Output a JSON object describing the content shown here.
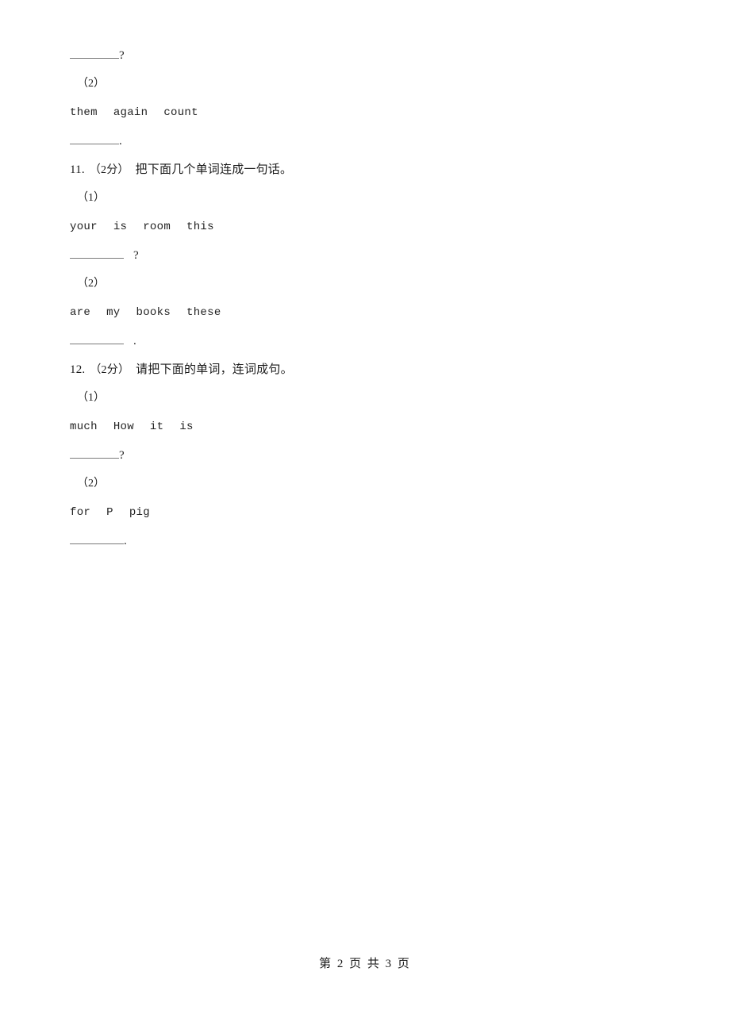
{
  "document": {
    "background_color": "#ffffff",
    "text_color": "#1a1a1a",
    "blank_color": "#7a7a7a"
  },
  "body_lines": [
    {
      "kind": "answer",
      "blank_width": "w62",
      "gap": false,
      "punct": "?"
    },
    {
      "kind": "sub-marker",
      "marker": "（2）"
    },
    {
      "kind": "words",
      "words": [
        "them",
        "again",
        "count"
      ]
    },
    {
      "kind": "answer",
      "blank_width": "w62",
      "gap": false,
      "punct": "."
    },
    {
      "kind": "question",
      "number": "11.",
      "score": "（2分）",
      "text": "把下面几个单词连成一句话。"
    },
    {
      "kind": "sub-marker",
      "marker": "（1）"
    },
    {
      "kind": "words",
      "words": [
        "your",
        "is",
        "room",
        "this"
      ]
    },
    {
      "kind": "answer",
      "blank_width": "w68",
      "gap": true,
      "punct": "?"
    },
    {
      "kind": "sub-marker",
      "marker": "（2）"
    },
    {
      "kind": "words",
      "words": [
        "are",
        "my",
        "books",
        "these"
      ]
    },
    {
      "kind": "answer",
      "blank_width": "w68",
      "gap": true,
      "punct": "."
    },
    {
      "kind": "question",
      "number": "12.",
      "score": "（2分）",
      "text": "请把下面的单词，连词成句。"
    },
    {
      "kind": "sub-marker",
      "marker": "（1）"
    },
    {
      "kind": "words",
      "words": [
        "much",
        "How",
        "it",
        "is"
      ]
    },
    {
      "kind": "answer",
      "blank_width": "w62",
      "gap": false,
      "punct": "?"
    },
    {
      "kind": "sub-marker",
      "marker": "（2）"
    },
    {
      "kind": "words",
      "words": [
        "for",
        "P",
        "pig"
      ]
    },
    {
      "kind": "answer",
      "blank_width": "w68",
      "gap": false,
      "punct": "."
    }
  ],
  "footer": {
    "text": "第 2 页 共 3 页"
  }
}
